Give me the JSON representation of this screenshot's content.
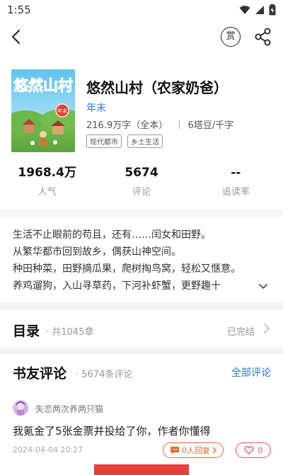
{
  "status_bar": {
    "time": "1:55"
  },
  "nav": {
    "reward_label": "赏"
  },
  "book": {
    "cover_title": "悠然山村",
    "cover_badge": "年末",
    "title": "悠然山村（农家奶爸）",
    "author": "年末",
    "word_count": "216.9万字（全本）",
    "price": "6塔豆/千字",
    "tags": [
      "现代都市",
      "乡土生活"
    ]
  },
  "stats": [
    {
      "value": "1968.4万",
      "label": "人气"
    },
    {
      "value": "5674",
      "label": "评论"
    },
    {
      "value": "--",
      "label": "追读率"
    }
  ],
  "description": [
    "生活不止眼前的苟且，还有……闰女和田野。",
    "从繁华都市回到故乡，偶获山神空间。",
    "种田种菜，田野摘瓜果，爬树掏鸟窝，轻松又惬意。",
    "养鸡遛狗，入山寻草药，下河补虾蟹，更野趣十"
  ],
  "catalog": {
    "title": "目录",
    "count": "· 共1045章",
    "status": "已完结"
  },
  "comments": {
    "title": "书友评论",
    "count": "· 5674条评论",
    "all_label": "全部评论",
    "items": [
      {
        "user": "失恋两次养两只猫",
        "text": "我氪金了5张金票并投给了你，作者你懂得",
        "date": "2024-04-04 20:27",
        "reply_label": "0人回复",
        "likes": "0"
      }
    ]
  },
  "colors": {
    "accent": "#2a77d6",
    "reply": "#e86a2b",
    "like": "#e84b6d",
    "cta": "#e5403b"
  }
}
